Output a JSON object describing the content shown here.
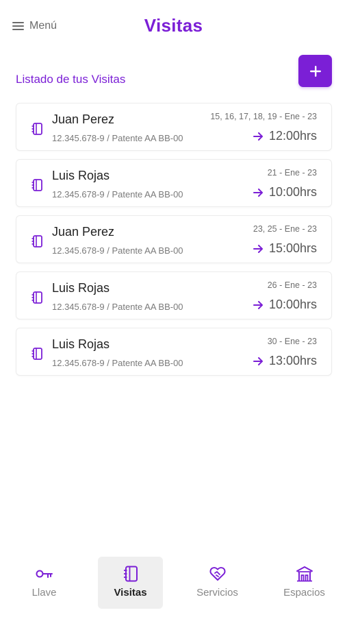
{
  "header": {
    "menu_label": "Menú",
    "title": "Visitas"
  },
  "section": {
    "title": "Listado de tus Visitas",
    "add_label": "+"
  },
  "visits": [
    {
      "name": "Juan Perez",
      "detail": "12.345.678-9 / Patente AA BB-00",
      "dates": "15, 16, 17, 18, 19 - Ene - 23",
      "time": "12:00hrs"
    },
    {
      "name": "Luis Rojas",
      "detail": "12.345.678-9 / Patente AA BB-00",
      "dates": "21 - Ene - 23",
      "time": "10:00hrs"
    },
    {
      "name": "Juan Perez",
      "detail": "12.345.678-9 / Patente AA BB-00",
      "dates": "23, 25 - Ene - 23",
      "time": "15:00hrs"
    },
    {
      "name": "Luis Rojas",
      "detail": "12.345.678-9 / Patente AA BB-00",
      "dates": "26 - Ene - 23",
      "time": "10:00hrs"
    },
    {
      "name": "Luis Rojas",
      "detail": "12.345.678-9 / Patente AA BB-00",
      "dates": "30 - Ene - 23",
      "time": "13:00hrs"
    }
  ],
  "nav": [
    {
      "label": "Llave",
      "icon": "key-icon"
    },
    {
      "label": "Visitas",
      "icon": "notebook-icon",
      "active": true
    },
    {
      "label": "Servicios",
      "icon": "heart-handshake-icon"
    },
    {
      "label": "Espacios",
      "icon": "building-icon"
    }
  ],
  "colors": {
    "accent": "#7b1fd6",
    "text": "#222222",
    "muted": "#7a7a7a",
    "nav_active_bg": "#efefef"
  }
}
